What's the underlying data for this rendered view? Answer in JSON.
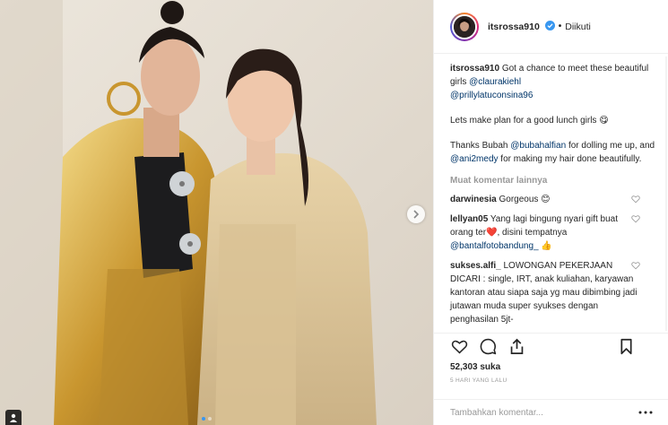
{
  "post": {
    "header": {
      "username": "itsrossa910",
      "separator": "•",
      "follow_status": "Diikuti"
    },
    "caption": {
      "username": "itsrossa910",
      "line1_text": "Got a chance to meet these beautiful girls",
      "mention1": "@claurakiehl",
      "mention2": "@prillylatuconsina96",
      "paragraph2": "Lets make plan for a good lunch girls 😋",
      "p3_a": "Thanks Bubah",
      "mention3": "@bubahalfian",
      "p3_b": "for dolling me up, and",
      "mention4": "@ani2medy",
      "p3_c": "for making my hair done beautifully."
    },
    "load_more": "Muat komentar lainnya",
    "comments": [
      {
        "username": "darwinesia",
        "text": "Gorgeous 😊"
      },
      {
        "username": "lellyan05",
        "text": "Yang lagi bingung nyari gift buat orang ter❤️, disini tempatnya",
        "mention": "@bantalfotobandung_",
        "suffix": "👍"
      },
      {
        "username": "sukses.alfi_",
        "text": "LOWONGAN PEKERJAAN DICARI : single, IRT, anak kuliahan, karyawan kantoran atau siapa saja yg mau dibimbing jadi jutawan muda super syukses dengan penghasilan 5jt-"
      }
    ],
    "likes": "52,303 suka",
    "timestamp": "5 HARI YANG LALU",
    "add_comment_placeholder": "Tambahkan komentar...",
    "icons": {
      "like": "heart-icon",
      "comment": "comment-icon",
      "share": "share-icon",
      "save": "bookmark-icon",
      "options": "more-options-icon",
      "next": "chevron-right-icon",
      "tag": "user-tag-icon",
      "verified": "verified-badge-icon"
    },
    "colors": {
      "accent": "#3897f0",
      "mention": "#003569",
      "muted": "#999999",
      "border": "#efefef",
      "text": "#262626"
    }
  }
}
